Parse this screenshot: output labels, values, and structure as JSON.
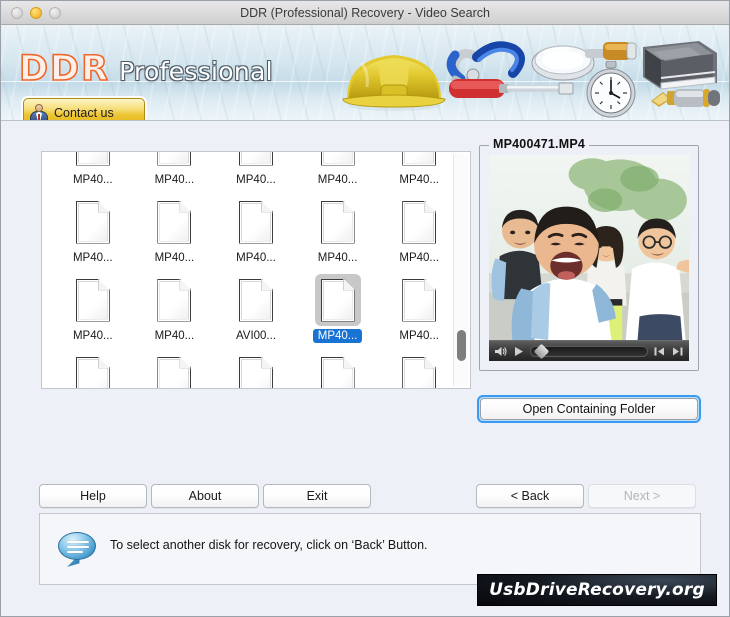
{
  "window": {
    "title": "DDR (Professional) Recovery - Video Search",
    "traffic_lights": [
      "close-disabled",
      "minimize-active",
      "zoom-disabled"
    ]
  },
  "banner": {
    "logo_primary": "DDR",
    "logo_secondary": "Professional",
    "contact_button": "Contact us",
    "tool_icons": [
      "hard-hat",
      "pliers",
      "screwdriver",
      "magnifier",
      "stopwatch",
      "book",
      "pen"
    ],
    "accent_orange": "#f0672a"
  },
  "file_list": {
    "rows": [
      {
        "cells": [
          {
            "name": "MP40...",
            "selected": false,
            "clipped_top": true
          },
          {
            "name": "MP40...",
            "selected": false,
            "clipped_top": true
          },
          {
            "name": "MP40...",
            "selected": false,
            "clipped_top": true
          },
          {
            "name": "MP40...",
            "selected": false,
            "clipped_top": true
          },
          {
            "name": "MP40...",
            "selected": false,
            "clipped_top": true
          }
        ]
      },
      {
        "cells": [
          {
            "name": "MP40...",
            "selected": false
          },
          {
            "name": "MP40...",
            "selected": false
          },
          {
            "name": "MP40...",
            "selected": false
          },
          {
            "name": "MP40...",
            "selected": false
          },
          {
            "name": "MP40...",
            "selected": false
          }
        ]
      },
      {
        "cells": [
          {
            "name": "MP40...",
            "selected": false
          },
          {
            "name": "MP40...",
            "selected": false
          },
          {
            "name": "AVI00...",
            "selected": false
          },
          {
            "name": "MP40...",
            "selected": true
          },
          {
            "name": "MP40...",
            "selected": false
          }
        ]
      },
      {
        "cells": [
          {
            "name": "",
            "selected": false
          },
          {
            "name": "",
            "selected": false
          },
          {
            "name": "",
            "selected": false
          },
          {
            "name": "",
            "selected": false
          },
          {
            "name": "",
            "selected": false
          }
        ]
      }
    ],
    "selection_color": "#1873d3",
    "scrollbar": {
      "thumb_top_pct": 76
    }
  },
  "preview": {
    "file_name": "MP400471.MP4",
    "player": {
      "volume_icon": "speaker-icon",
      "play_icon": "play-icon",
      "step_back_icon": "step-back-icon",
      "step_forward_icon": "step-forward-icon",
      "scrub_position_pct": 4
    }
  },
  "actions": {
    "open_containing_folder": "Open Containing Folder",
    "help": "Help",
    "about": "About",
    "exit": "Exit",
    "back": "< Back",
    "next": "Next >",
    "next_disabled": true,
    "focus_ring_color": "#3b9bf0"
  },
  "status": {
    "icon": "speech-bubble-icon",
    "message": "To select another disk for recovery, click on ‘Back’ Button."
  },
  "watermark": {
    "text": "UsbDriveRecovery.org"
  }
}
